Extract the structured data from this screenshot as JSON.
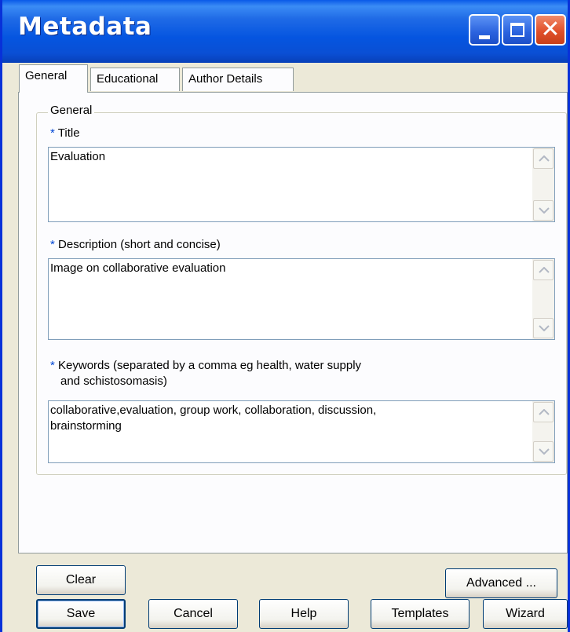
{
  "window": {
    "title": "Metadata"
  },
  "tabs": [
    {
      "label": "General"
    },
    {
      "label": "Educational"
    },
    {
      "label": "Author Details"
    }
  ],
  "group": {
    "title": "General",
    "required_marker": "*",
    "title_field": {
      "label": "Title",
      "value": "Evaluation"
    },
    "description_field": {
      "label": "Description (short and concise)",
      "value": "Image on collaborative evaluation"
    },
    "keywords_field": {
      "label_line1": "Keywords (separated by a comma eg health, water supply",
      "label_line2": "and schistosomasis)",
      "value_line1": "collaborative,evaluation, group work, collaboration, discussion,",
      "value_line2": "brainstorming"
    }
  },
  "panel_buttons": {
    "clear": "Clear",
    "advanced": "Advanced ..."
  },
  "footer_buttons": {
    "save": "Save",
    "cancel": "Cancel",
    "help": "Help",
    "templates": "Templates",
    "wizard": "Wizard"
  },
  "colors": {
    "titlebar": "#0a5ae8",
    "required_marker": "#0046d5",
    "close_button": "#e1502a"
  }
}
